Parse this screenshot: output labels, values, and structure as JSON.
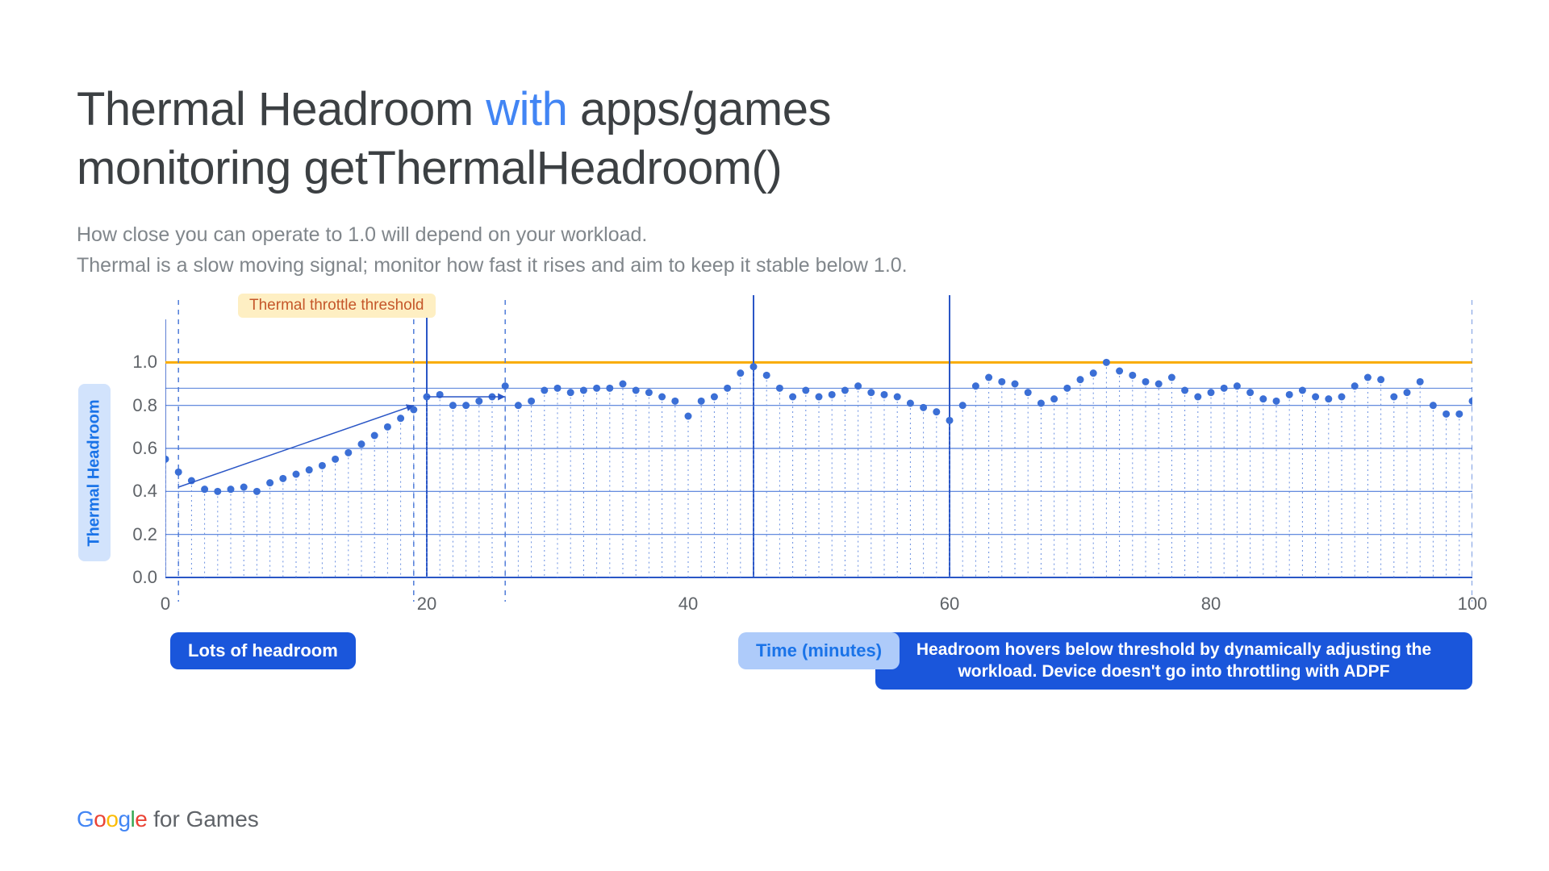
{
  "title_pre": "Thermal Headroom ",
  "title_accent": "with",
  "title_post": " apps/games\nmonitoring getThermalHeadroom()",
  "subtitle": "How close you can operate to 1.0 will depend on your workload.\nThermal is a slow moving signal; monitor how fast it rises and aim to keep it stable below 1.0.",
  "ylabel": "Thermal Headroom",
  "xlabel": "Time (minutes)",
  "threshold_label": "Thermal throttle threshold",
  "annot_left": "Lots of headroom",
  "annot_right": "Headroom hovers below threshold by dynamically adjusting the workload. Device doesn't go into throttling with ADPF",
  "footer_brand": "Google",
  "footer_suffix": " for Games",
  "chart_data": {
    "type": "scatter",
    "xlabel": "Time (minutes)",
    "ylabel": "Thermal Headroom",
    "xlim": [
      0,
      100
    ],
    "ylim": [
      0.0,
      1.2
    ],
    "yticks": [
      0.0,
      0.2,
      0.4,
      0.6,
      0.8,
      1.0
    ],
    "xticks": [
      0,
      20,
      40,
      60,
      80,
      100
    ],
    "threshold": 1.0,
    "guide_line": 0.88,
    "vertical_dashed_markers": [
      1,
      19,
      26,
      100
    ],
    "vertical_solid_markers": [
      20,
      45,
      60
    ],
    "x": [
      0,
      1,
      2,
      3,
      4,
      5,
      6,
      7,
      8,
      9,
      10,
      11,
      12,
      13,
      14,
      15,
      16,
      17,
      18,
      19,
      20,
      21,
      22,
      23,
      24,
      25,
      26,
      27,
      28,
      29,
      30,
      31,
      32,
      33,
      34,
      35,
      36,
      37,
      38,
      39,
      40,
      41,
      42,
      43,
      44,
      45,
      46,
      47,
      48,
      49,
      50,
      51,
      52,
      53,
      54,
      55,
      56,
      57,
      58,
      59,
      60,
      61,
      62,
      63,
      64,
      65,
      66,
      67,
      68,
      69,
      70,
      71,
      72,
      73,
      74,
      75,
      76,
      77,
      78,
      79,
      80,
      81,
      82,
      83,
      84,
      85,
      86,
      87,
      88,
      89,
      90,
      91,
      92,
      93,
      94,
      95,
      96,
      97,
      98,
      99,
      100
    ],
    "y": [
      0.55,
      0.49,
      0.45,
      0.41,
      0.4,
      0.41,
      0.42,
      0.4,
      0.44,
      0.46,
      0.48,
      0.5,
      0.52,
      0.55,
      0.58,
      0.62,
      0.66,
      0.7,
      0.74,
      0.78,
      0.84,
      0.85,
      0.8,
      0.8,
      0.82,
      0.84,
      0.89,
      0.8,
      0.82,
      0.87,
      0.88,
      0.86,
      0.87,
      0.88,
      0.88,
      0.9,
      0.87,
      0.86,
      0.84,
      0.82,
      0.75,
      0.82,
      0.84,
      0.88,
      0.95,
      0.98,
      0.94,
      0.88,
      0.84,
      0.87,
      0.84,
      0.85,
      0.87,
      0.89,
      0.86,
      0.85,
      0.84,
      0.81,
      0.79,
      0.77,
      0.73,
      0.8,
      0.89,
      0.93,
      0.91,
      0.9,
      0.86,
      0.81,
      0.83,
      0.88,
      0.92,
      0.95,
      1.0,
      0.96,
      0.94,
      0.91,
      0.9,
      0.93,
      0.87,
      0.84,
      0.86,
      0.88,
      0.89,
      0.86,
      0.83,
      0.82,
      0.85,
      0.87,
      0.84,
      0.83,
      0.84,
      0.89,
      0.93,
      0.92,
      0.84,
      0.86,
      0.91,
      0.8,
      0.76,
      0.76,
      0.82
    ],
    "annotations": [
      {
        "kind": "arrow",
        "from": [
          1,
          0.42
        ],
        "to": [
          19,
          0.8
        ],
        "note": "rising trend"
      },
      {
        "kind": "arrow",
        "from": [
          20,
          0.84
        ],
        "to": [
          26,
          0.84
        ],
        "note": "horizontal"
      }
    ]
  }
}
